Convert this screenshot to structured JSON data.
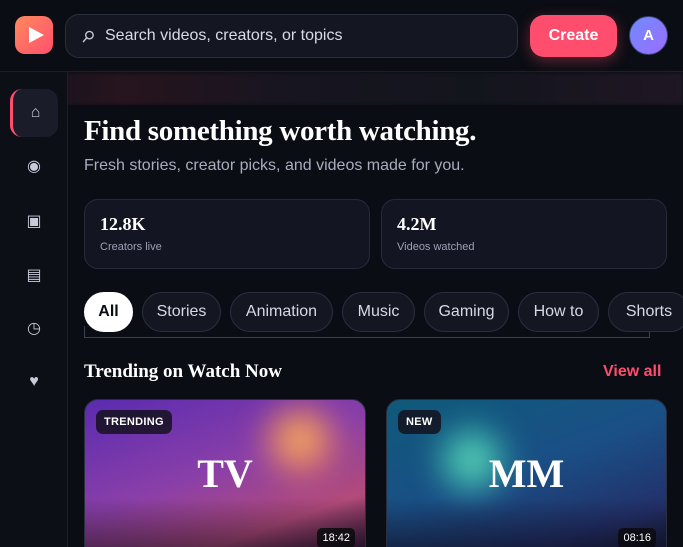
{
  "header": {
    "search_placeholder": "Search videos, creators, or topics",
    "create_label": "Create",
    "avatar_initial": "A"
  },
  "sidebar": {
    "items": [
      {
        "icon": "home-icon",
        "glyph": "⌂",
        "active": true
      },
      {
        "icon": "explore-icon",
        "glyph": "◉",
        "active": false
      },
      {
        "icon": "subscriptions-icon",
        "glyph": "▣",
        "active": false
      },
      {
        "icon": "library-icon",
        "glyph": "▤",
        "active": false
      },
      {
        "icon": "history-icon",
        "glyph": "◷",
        "active": false
      },
      {
        "icon": "liked-icon",
        "glyph": "♥",
        "active": false
      }
    ]
  },
  "hero": {
    "title": "Find something worth watching.",
    "subtitle": "Fresh stories, creator picks, and videos made for you."
  },
  "stats": [
    {
      "value": "12.8K",
      "label": "Creators live"
    },
    {
      "value": "4.2M",
      "label": "Videos watched"
    }
  ],
  "categories": [
    "All",
    "Stories",
    "Animation",
    "Music",
    "Gaming",
    "How to",
    "Shorts"
  ],
  "trending": {
    "title": "Trending on Watch Now",
    "view_all": "View all",
    "cards": [
      {
        "badge": "TRENDING",
        "monogram": "TV",
        "duration": "18:42"
      },
      {
        "badge": "NEW",
        "monogram": "MM",
        "duration": "08:16"
      }
    ]
  },
  "colors": {
    "accent": "#ff4d6d",
    "background": "#0b0d14",
    "surface": "#141722"
  }
}
